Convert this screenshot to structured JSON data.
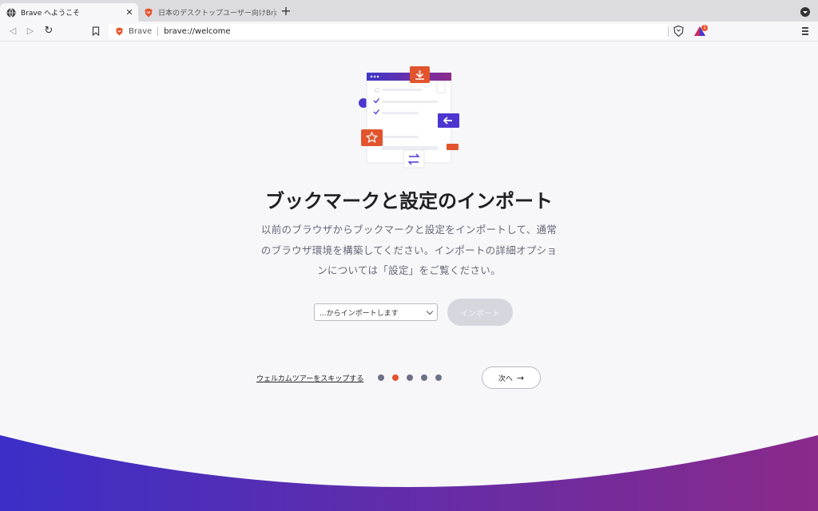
{
  "tabs": [
    {
      "title": "Brave へようこそ",
      "close": "✕",
      "active": true
    },
    {
      "title": "日本のデスクトップユーザー向けBrave",
      "active": false
    }
  ],
  "newtab_label": "+",
  "toolbar": {
    "back_icon": "◁",
    "forward_icon": "▷",
    "reload_icon": "↻",
    "site_label": "Brave",
    "url": "brave://welcome",
    "rewards_badge": "1"
  },
  "main": {
    "heading": "ブックマークと設定のインポート",
    "description": [
      "以前のブラウザからブックマークと設定をインポートして、通常",
      "のブラウザ環境を構築してください。インポートの詳細オプショ",
      "ンについては「設定」をご覧ください。"
    ],
    "import_select": "...からインポートします",
    "import_button": "インポート",
    "skip_link": "ウェルカムツアーをスキップする",
    "next_button": "次へ",
    "next_arrow": "→",
    "steps_total": 5,
    "steps_current": 2
  },
  "colors": {
    "accent_orange": "#e2542d",
    "brand_purple": "#4c36d0",
    "wave_start": "#3b2fc8",
    "wave_end": "#8a2a8a"
  }
}
